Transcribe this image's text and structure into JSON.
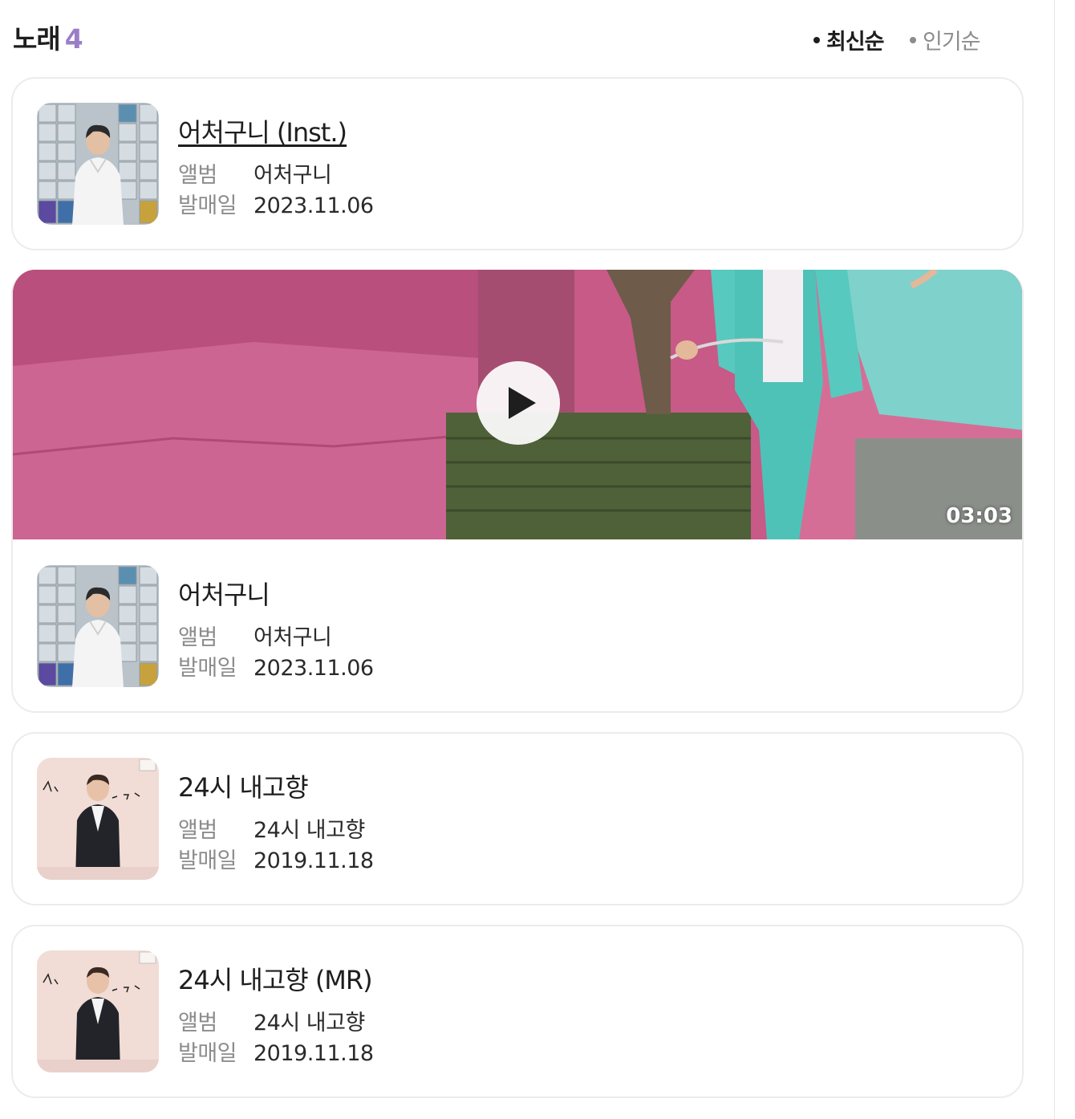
{
  "section": {
    "title": "노래",
    "count": "4",
    "sort_options": [
      {
        "label": "최신순",
        "active": true
      },
      {
        "label": "인기순",
        "active": false
      }
    ]
  },
  "labels": {
    "album": "앨범",
    "release_date": "발매일"
  },
  "songs": [
    {
      "title": "어처구니 (Inst.)",
      "album": "어처구니",
      "date": "2023.11.06",
      "has_video": false
    },
    {
      "title": "어처구니",
      "album": "어처구니",
      "date": "2023.11.06",
      "has_video": true,
      "video_duration": "03:03"
    },
    {
      "title": "24시 내고향",
      "album": "24시 내고향",
      "date": "2019.11.18",
      "has_video": false
    },
    {
      "title": "24시 내고향 (MR)",
      "album": "24시 내고향",
      "date": "2019.11.18",
      "has_video": false
    }
  ],
  "colors": {
    "accent_count": "#9a7fc7",
    "muted": "#8c8c8c",
    "border": "#ececec"
  }
}
